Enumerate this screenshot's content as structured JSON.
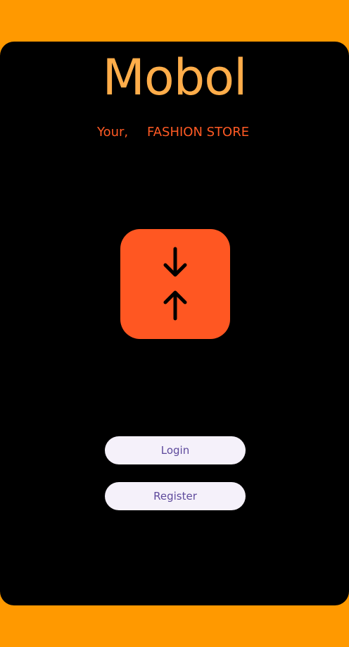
{
  "app": {
    "brand": "Mobol",
    "tagline_prefix": "Your,",
    "tagline_main": "FASHION STORE"
  },
  "logo": {
    "icon": "compress-vertical-arrows-icon",
    "tile_color": "#FF5722"
  },
  "actions": {
    "login_label": "Login",
    "register_label": "Register"
  },
  "colors": {
    "background": "#FF9900",
    "card": "#000000",
    "brand": "#FFAD4A",
    "tagline": "#FF5A24",
    "button_bg": "#F5F1FA",
    "button_text": "#5E4A9C"
  }
}
